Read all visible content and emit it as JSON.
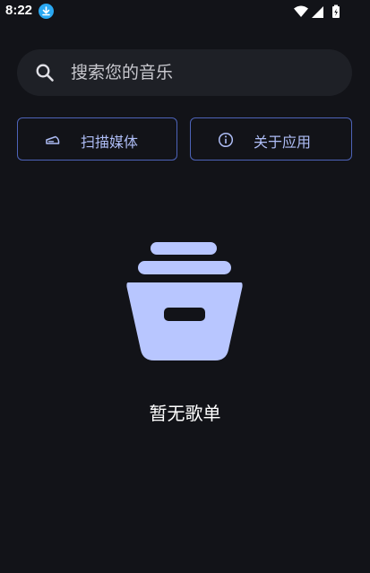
{
  "status_bar": {
    "time": "8:22",
    "icons": [
      "download-icon",
      "wifi-icon",
      "signal-icon",
      "battery-icon"
    ],
    "download_color": "#2aa8f2"
  },
  "search": {
    "placeholder": "搜索您的音乐",
    "value": "",
    "icon": "search-icon"
  },
  "actions": {
    "scan_label": "扫描媒体",
    "scan_icon": "scanner-icon",
    "about_label": "关于应用",
    "about_icon": "info-icon"
  },
  "empty_state": {
    "icon": "archive-box-icon",
    "message": "暂无歌单"
  },
  "colors": {
    "background": "#121318",
    "surface": "#1e2026",
    "outline": "#4d63b8",
    "accent": "#aebdf6",
    "illustration": "#b8c6ff"
  }
}
